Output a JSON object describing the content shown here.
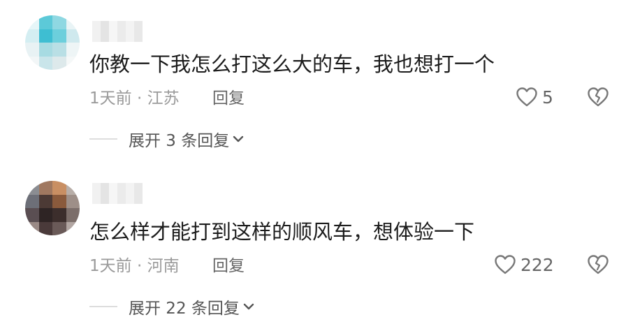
{
  "comments": [
    {
      "text": "你教一下我怎么打这么大的车，我也想打一个",
      "meta": "1天前 · 江苏",
      "reply_label": "回复",
      "likes": "5",
      "expand_label": "展开 3 条回复",
      "icons": {
        "like": "heart-outline-icon",
        "dislike": "broken-heart-icon",
        "expand": "chevron-down-icon"
      }
    },
    {
      "text": "怎么样才能打到这样的顺风车，想体验一下",
      "meta": "1天前 · 河南",
      "reply_label": "回复",
      "likes": "222",
      "expand_label": "展开 22 条回复",
      "icons": {
        "like": "heart-outline-icon",
        "dislike": "broken-heart-icon",
        "expand": "chevron-down-icon"
      }
    }
  ],
  "colors": {
    "text": "#1c1c1c",
    "meta": "#9a9a9a",
    "action": "#666666"
  }
}
